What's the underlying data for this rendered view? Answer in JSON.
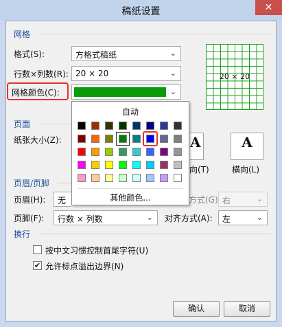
{
  "window": {
    "title": "稿纸设置",
    "close_label": "✕"
  },
  "grid_section": {
    "title": "网格",
    "format_label": "格式(S):",
    "format_value": "方格式稿纸",
    "rowcol_label": "行数×列数(R):",
    "rowcol_value": "20 × 20",
    "color_label": "网格颜色(C):",
    "color_value": "#0a9a0a",
    "preview_text": "20 × 20",
    "grid_color": "#19a319"
  },
  "page_section": {
    "title": "页面",
    "paper_size_label": "纸张大小(Z):",
    "portrait_label": "向(T)",
    "landscape_label": "横向(L)",
    "orient_glyph": "A"
  },
  "header_section": {
    "title": "页眉/页脚",
    "header_label": "页眉(H):",
    "header_value": "无",
    "footer_label": "页脚(F):",
    "footer_value": "行数 × 列数",
    "header_align_label": "方式(G):",
    "header_align_value": "右",
    "footer_align_label": "对齐方式(A):",
    "footer_align_value": "左"
  },
  "wrap_section": {
    "title": "换行",
    "opt1_label": "按中文习惯控制首尾字符(U)",
    "opt1_checked": "",
    "opt2_label": "允许标点溢出边界(N)",
    "opt2_checked": "✔"
  },
  "buttons": {
    "ok_label": "确认",
    "cancel_label": "取消"
  },
  "palette": {
    "auto_label": "自动",
    "more_label": "其他颜色...",
    "rows": [
      [
        "#000000",
        "#993300",
        "#333300",
        "#003300",
        "#003366",
        "#000080",
        "#333399",
        "#333333"
      ],
      [
        "#800000",
        "#ff6600",
        "#808000",
        "#008000",
        "#008080",
        "#0000ff",
        "#666699",
        "#808080"
      ],
      [
        "#ff0000",
        "#ff9900",
        "#99cc00",
        "#339966",
        "#33cccc",
        "#3366ff",
        "#800080",
        "#969696"
      ],
      [
        "#ff00ff",
        "#ffcc00",
        "#ffff00",
        "#00ff00",
        "#00ffff",
        "#00ccff",
        "#993366",
        "#c0c0c0"
      ],
      [
        "#ff99cc",
        "#ffcc99",
        "#ffff99",
        "#ccffcc",
        "#ccffff",
        "#99ccff",
        "#cc99ff",
        "#ffffff"
      ]
    ],
    "selected": "#008000",
    "highlighted": "#0000ff"
  },
  "arrow_glyph": "⌄"
}
